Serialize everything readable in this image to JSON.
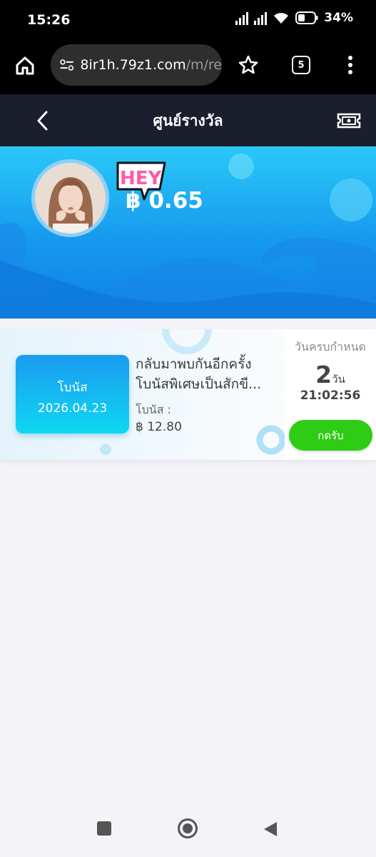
{
  "status": {
    "time": "15:26",
    "battery": "34%"
  },
  "browser": {
    "url_host": "8ir1h.79z1.com",
    "url_path": "/m/re",
    "tab_count": "5"
  },
  "header": {
    "title": "ศูนย์รางวัล"
  },
  "profile": {
    "badge": "HEY",
    "balance": "฿ 0.65"
  },
  "bonus_card": {
    "box_label": "โบนัส",
    "box_date": "2026.04.23",
    "title_line1": "กลับมาพบกันอีกครั้ง",
    "title_line2": "โบนัสพิเศษเป็นสักขี...",
    "bonus_label": "โบนัส :",
    "bonus_amount": "฿ 12.80",
    "deadline_label": "วันครบกำหนด",
    "days": "2",
    "days_unit": "วัน",
    "countdown": "21:02:56",
    "claim_label": "กดรับ"
  },
  "colors": {
    "header_bg": "#1b1e2d",
    "banner_top": "#2bc8f8",
    "banner_bottom": "#0f7fe6",
    "claim_green": "#2fcc15",
    "page_bg": "#f3f3f8"
  },
  "icons": [
    "signal-icon",
    "wifi-icon",
    "battery-icon",
    "home-icon",
    "site-settings-icon",
    "star-icon",
    "tabs-icon",
    "more-icon",
    "back-icon",
    "ticket-icon",
    "square-nav-icon",
    "home-nav-icon",
    "back-nav-icon"
  ]
}
